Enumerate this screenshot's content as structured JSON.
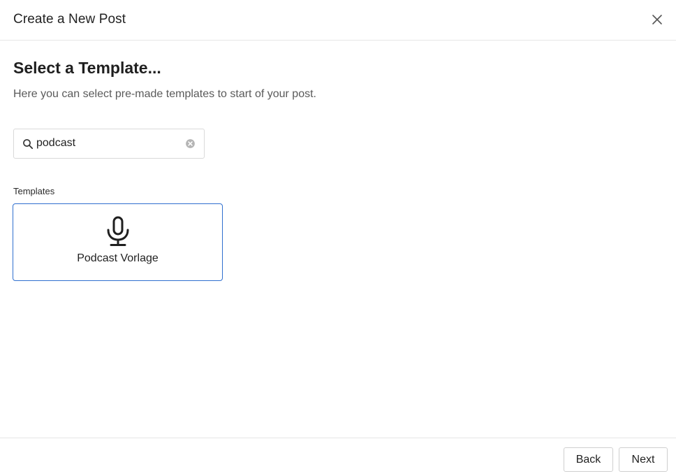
{
  "dialog": {
    "title": "Create a New Post",
    "close_icon": "close-icon"
  },
  "main": {
    "heading": "Select a Template...",
    "description": "Here you can select pre-made templates to start of your post.",
    "search": {
      "value": "podcast",
      "placeholder": "",
      "search_icon": "search-icon",
      "clear_icon": "clear-circle-icon"
    },
    "templates_label": "Templates",
    "templates": [
      {
        "label": "Podcast Vorlage",
        "icon": "microphone-icon",
        "selected": true
      }
    ]
  },
  "footer": {
    "back_label": "Back",
    "next_label": "Next"
  },
  "colors": {
    "selected_border": "#2f6fcf",
    "divider": "#e6e6e6",
    "muted_text": "#5a5a5a"
  }
}
